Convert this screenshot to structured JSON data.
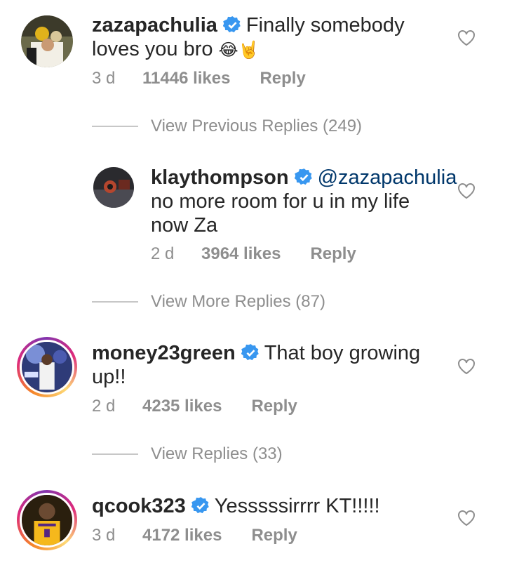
{
  "comments": [
    {
      "username": "zazapachulia",
      "text_line1": "Finally somebody",
      "text_line2": "loves you bro",
      "emoji": "😂🤘",
      "time": "3 d",
      "likes": "11446 likes",
      "reply": "Reply"
    },
    {
      "username": "klaythompson",
      "mention": "@zazapachulia",
      "text_line1": "no more room for u in my life",
      "text_line2": "now Za",
      "time": "2 d",
      "likes": "3964 likes",
      "reply": "Reply"
    },
    {
      "username": "money23green",
      "text_line1": "That boy growing",
      "text_line2": "up!!",
      "time": "2 d",
      "likes": "4235 likes",
      "reply": "Reply"
    },
    {
      "username": "qcook323",
      "text_line1": "Yesssssirrrr KT!!!!!",
      "time": "3 d",
      "likes": "4172 likes",
      "reply": "Reply"
    }
  ],
  "reply_toggles": [
    "View Previous Replies (249)",
    "View More Replies (87)",
    "View Replies (33)"
  ],
  "colors": {
    "verified": "#3897f0",
    "mention": "#00376b",
    "meta": "#8e8e8e"
  }
}
